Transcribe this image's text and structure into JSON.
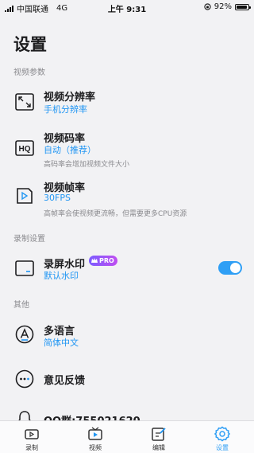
{
  "status_bar": {
    "carrier": "中国联通",
    "network": "4G",
    "time": "上午 9:31",
    "battery": "92%",
    "battery_level": 0.92
  },
  "header": {
    "title": "设置"
  },
  "sections": {
    "video": "视频参数",
    "recording": "录制设置",
    "other": "其他"
  },
  "settings": {
    "resolution": {
      "title": "视频分辨率",
      "value": "手机分辨率",
      "icon": "resize-icon"
    },
    "bitrate": {
      "title": "视频码率",
      "value": "自动（推荐）",
      "desc": "高码率会增加视频文件大小",
      "icon": "hq-icon"
    },
    "framerate": {
      "title": "视频帧率",
      "value": "30FPS",
      "desc": "高帧率会使视频更流畅，但需要更多CPU资源",
      "icon": "play-icon"
    },
    "watermark": {
      "title": "录屏水印",
      "value": "默认水印",
      "badge": "PRO",
      "enabled": true,
      "icon": "screen-icon"
    },
    "language": {
      "title": "多语言",
      "value": "简体中文",
      "icon": "language-icon"
    },
    "feedback": {
      "title": "意见反馈",
      "icon": "chat-icon"
    },
    "qq": {
      "title": "QQ群:755021620",
      "icon": "qq-icon"
    }
  },
  "tab_bar": {
    "tabs": [
      {
        "label": "录制",
        "icon": "camera-icon"
      },
      {
        "label": "视频",
        "icon": "video-icon"
      },
      {
        "label": "编辑",
        "icon": "edit-icon"
      },
      {
        "label": "设置",
        "icon": "gear-icon"
      }
    ],
    "active": 3
  },
  "colors": {
    "accent": "#2f9ff5",
    "link": "#2196f3",
    "background": "#f2f2f4",
    "pro_gradient_start": "#7b5cff",
    "pro_gradient_end": "#c04ef0"
  }
}
